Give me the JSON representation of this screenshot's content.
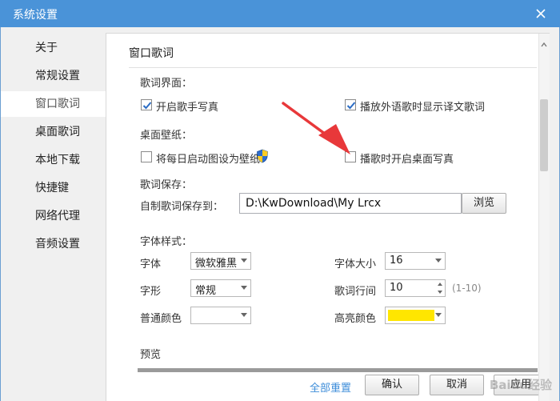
{
  "window": {
    "title": "系统设置",
    "close_icon": "close-icon"
  },
  "sidebar": {
    "items": [
      {
        "label": "关于",
        "active": false
      },
      {
        "label": "常规设置",
        "active": false
      },
      {
        "label": "窗口歌词",
        "active": true
      },
      {
        "label": "桌面歌词",
        "active": false
      },
      {
        "label": "本地下载",
        "active": false
      },
      {
        "label": "快捷键",
        "active": false
      },
      {
        "label": "网络代理",
        "active": false
      },
      {
        "label": "音频设置",
        "active": false
      }
    ]
  },
  "main": {
    "section_title": "窗口歌词",
    "lyrics_ui": {
      "heading": "歌词界面：",
      "show_singer_photo": {
        "label": "开启歌手写真",
        "checked": true
      },
      "show_translation": {
        "label": "播放外语歌时显示译文歌词",
        "checked": true
      }
    },
    "desktop_wallpaper": {
      "heading": "桌面壁纸：",
      "daily_wallpaper": {
        "label": "将每日启动图设为壁纸",
        "checked": false,
        "icon": "shield-icon"
      },
      "desktop_photo": {
        "label": "播歌时开启桌面写真",
        "checked": false
      }
    },
    "lyrics_save": {
      "heading": "歌词保存：",
      "path_label": "自制歌词保存到：",
      "path_value": "D:\\KwDownload\\My Lrcx",
      "browse_button": "浏览"
    },
    "font_style": {
      "heading": "字体样式：",
      "font_label": "字体",
      "font_value": "微软雅黑",
      "style_label": "字形",
      "style_value": "常规",
      "normal_color_label": "普通颜色",
      "normal_color": "#ffffff",
      "size_label": "字体大小",
      "size_value": "16",
      "line_spacing_label": "歌词行间",
      "line_spacing_value": "10",
      "line_spacing_range": "(1-10)",
      "highlight_color_label": "高亮颜色",
      "highlight_color": "#ffe600"
    },
    "preview_heading": "预览"
  },
  "footer": {
    "reset_link": "全部重置",
    "confirm_button": "确认",
    "cancel_button": "取消",
    "apply_button": "应用"
  },
  "watermark": "Baidu经验",
  "colors": {
    "titlebar": "#4a93d8",
    "link": "#3d8dd9",
    "arrow": "#e8383a"
  }
}
